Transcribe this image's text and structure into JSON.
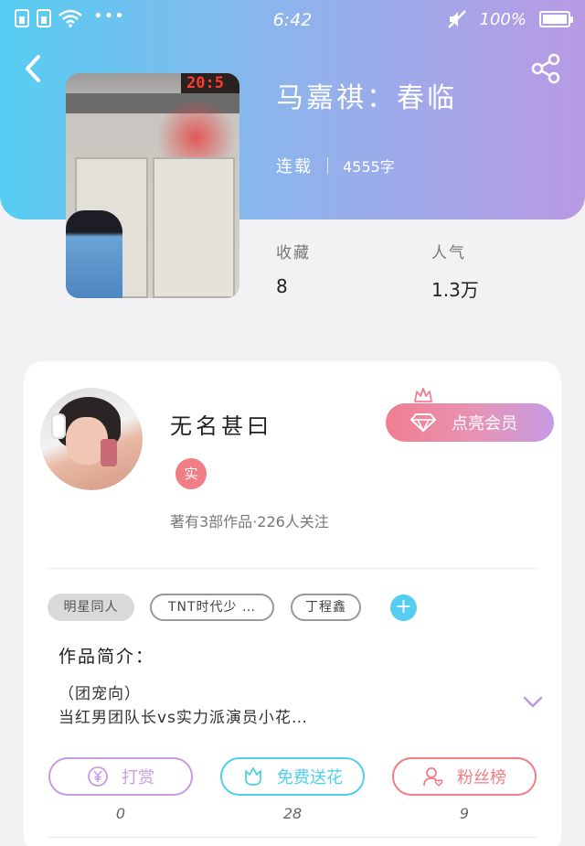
{
  "status_bar": {
    "time": "6:42",
    "battery": "100%"
  },
  "book": {
    "title": "马嘉祺：春临",
    "status": "连载",
    "word_count": "4555字",
    "stats": [
      {
        "label": "收藏",
        "value": "8"
      },
      {
        "label": "人气",
        "value": "1.3万"
      }
    ],
    "cover_sign": "20:5"
  },
  "author": {
    "name": "无名甚曰",
    "real_badge": "实",
    "info": "著有3部作品·226人关注",
    "vip_button": "点亮会员"
  },
  "tags": [
    "明星同人",
    "TNT时代少 …",
    "丁程鑫"
  ],
  "intro": {
    "title": "作品简介：",
    "lines": [
      "（团宠向）",
      "当红男团队长vs实力派演员小花…"
    ]
  },
  "actions": [
    {
      "label": "打赏",
      "count": "0",
      "color": "#c99be6",
      "icon": "yen-icon"
    },
    {
      "label": "免费送花",
      "count": "28",
      "color": "#4fd0ea",
      "icon": "flower-icon"
    },
    {
      "label": "粉丝榜",
      "count": "9",
      "color": "#f07d83",
      "icon": "fan-ranking-icon"
    }
  ],
  "colors": {
    "header_start": "#56cdf2",
    "header_end": "#b89ae4",
    "add_button": "#55cdf0",
    "real_badge": "#f17d86"
  }
}
